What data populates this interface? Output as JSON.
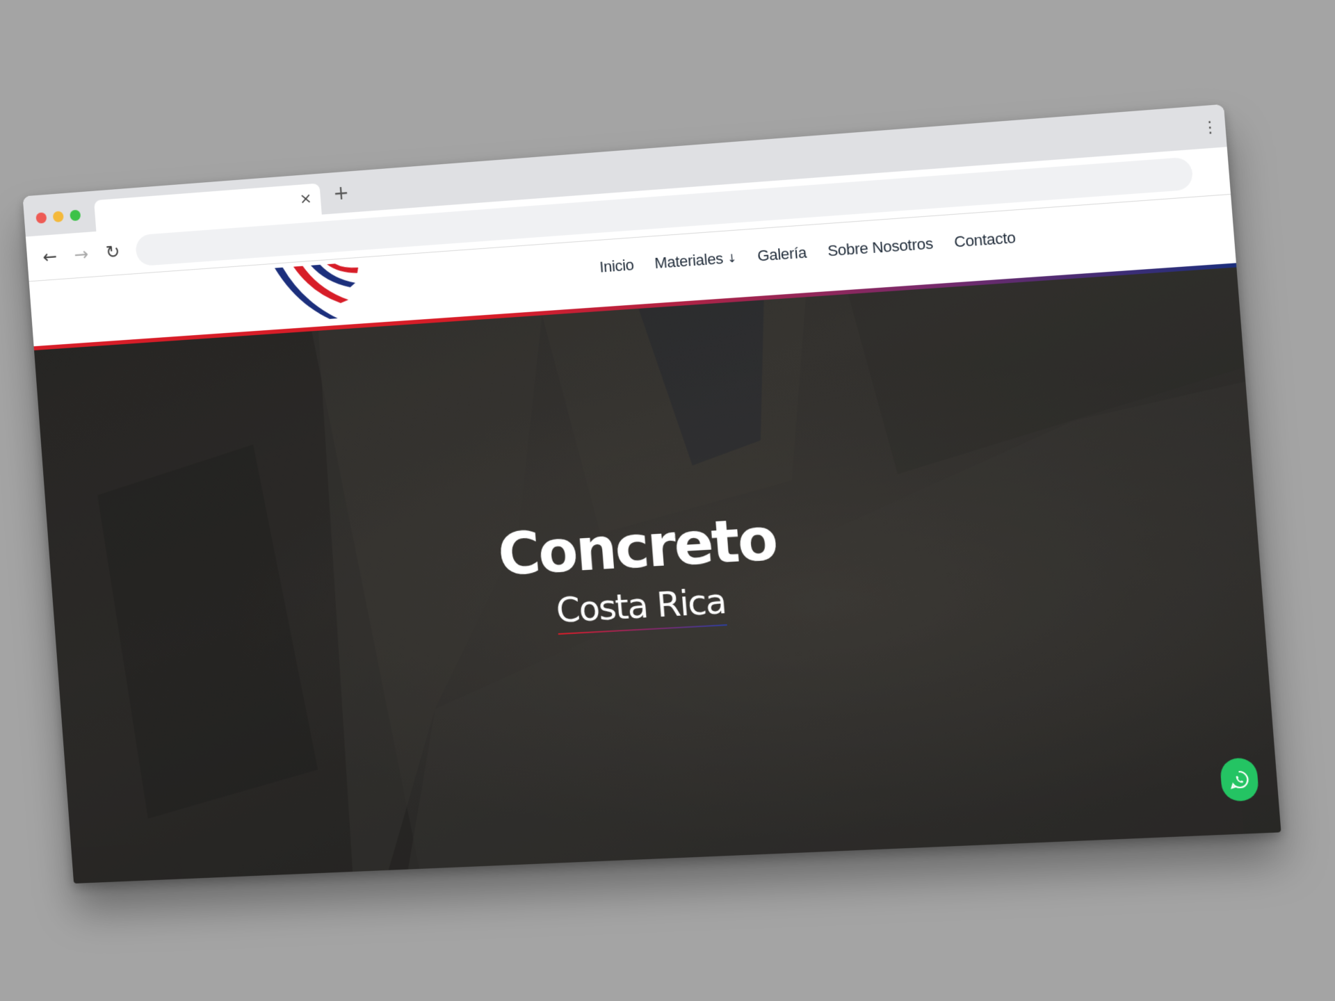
{
  "browser": {
    "tab_close_symbol": "×",
    "new_tab_symbol": "+",
    "menu_symbol": "⋮",
    "back_symbol": "←",
    "forward_symbol": "→",
    "reload_symbol": "↻",
    "colors": {
      "close": "#ee5b55",
      "minimize": "#f4b93b",
      "maximize": "#3cc248"
    }
  },
  "site": {
    "nav": {
      "items": [
        {
          "label": "Inicio"
        },
        {
          "label": "Materiales",
          "arrow": "↓"
        },
        {
          "label": "Galería"
        },
        {
          "label": "Sobre Nosotros"
        },
        {
          "label": "Contacto"
        }
      ]
    },
    "hero": {
      "title": "Concreto",
      "subtitle": "Costa Rica"
    },
    "colors": {
      "brand_red": "#d71d28",
      "brand_blue": "#1c2f7c",
      "whatsapp": "#24c463"
    },
    "icons": {
      "logo": "stripes-logo",
      "whatsapp": "whatsapp-icon"
    }
  }
}
